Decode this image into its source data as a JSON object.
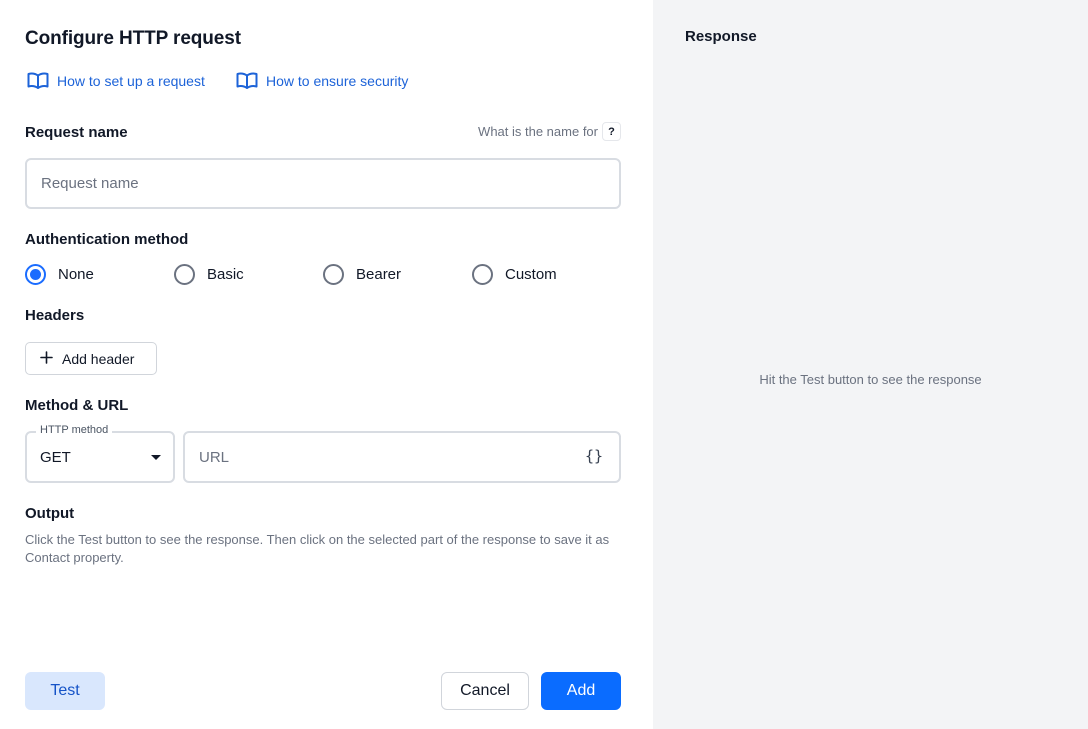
{
  "dialog": {
    "title": "Configure HTTP request"
  },
  "help_links": {
    "setup": "How to set up a request",
    "security": "How to ensure security"
  },
  "request_name": {
    "label": "Request name",
    "hint": "What is the name for",
    "hint_icon": "?",
    "placeholder": "Request name",
    "value": ""
  },
  "auth": {
    "label": "Authentication method",
    "options": [
      {
        "label": "None",
        "selected": true
      },
      {
        "label": "Basic",
        "selected": false
      },
      {
        "label": "Bearer",
        "selected": false
      },
      {
        "label": "Custom",
        "selected": false
      }
    ]
  },
  "headers": {
    "label": "Headers",
    "add_label": "Add header"
  },
  "method_url": {
    "label": "Method & URL",
    "method_legend": "HTTP method",
    "method_value": "GET",
    "url_placeholder": "URL",
    "url_value": "",
    "variable_icon": "{}"
  },
  "output": {
    "label": "Output",
    "description": "Click the Test button to see the response. Then click on the selected part of the response to save it as Contact property."
  },
  "actions": {
    "test": "Test",
    "cancel": "Cancel",
    "add": "Add"
  },
  "response": {
    "title": "Response",
    "empty": "Hit the Test button to see the response"
  },
  "colors": {
    "accent": "#0a6cff",
    "link": "#1d63d8",
    "test_button_bg": "#d9e7fd",
    "panel_bg": "#f3f4f6"
  },
  "icons": {
    "help_link": "book-icon",
    "add_header": "plus-icon",
    "method_dropdown": "caret-down-icon"
  }
}
